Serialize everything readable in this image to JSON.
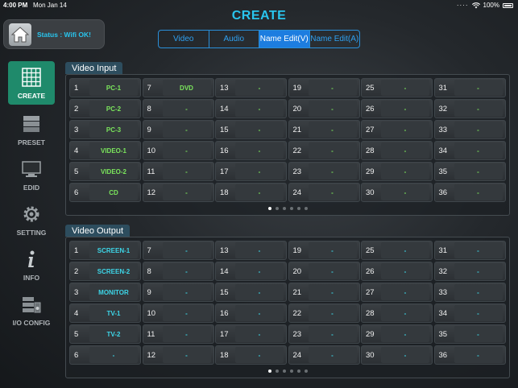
{
  "status_bar": {
    "time": "4:00 PM",
    "date": "Mon Jan 14",
    "battery": "100%"
  },
  "title": "CREATE",
  "status": {
    "text": "Status : Wifi OK!"
  },
  "tabs": [
    {
      "label": "Video",
      "active": false
    },
    {
      "label": "Audio",
      "active": false
    },
    {
      "label": "Name Edit(V)",
      "active": true
    },
    {
      "label": "Name Edit(A)",
      "active": false
    }
  ],
  "sidebar": [
    {
      "label": "CREATE",
      "icon": "grid-icon",
      "active": true
    },
    {
      "label": "PRESET",
      "icon": "preset-icon",
      "active": false
    },
    {
      "label": "EDID",
      "icon": "monitor-icon",
      "active": false
    },
    {
      "label": "SETTING",
      "icon": "gear-icon",
      "active": false
    },
    {
      "label": "INFO",
      "icon": "info-icon",
      "active": false
    },
    {
      "label": "I/O CONFIG",
      "icon": "io-config-icon",
      "active": false
    }
  ],
  "video_input": {
    "title": "Video Input",
    "page_count": 6,
    "current_page": 1,
    "cells": [
      {
        "n": "1",
        "name": "PC-1"
      },
      {
        "n": "2",
        "name": "PC-2"
      },
      {
        "n": "3",
        "name": "PC-3"
      },
      {
        "n": "4",
        "name": "VIDEO-1"
      },
      {
        "n": "5",
        "name": "VIDEO-2"
      },
      {
        "n": "6",
        "name": "CD"
      },
      {
        "n": "7",
        "name": "DVD"
      },
      {
        "n": "8",
        "name": "-"
      },
      {
        "n": "9",
        "name": "-"
      },
      {
        "n": "10",
        "name": "-"
      },
      {
        "n": "11",
        "name": "-"
      },
      {
        "n": "12",
        "name": "-"
      },
      {
        "n": "13",
        "name": "-"
      },
      {
        "n": "14",
        "name": "-"
      },
      {
        "n": "15",
        "name": "-"
      },
      {
        "n": "16",
        "name": "-"
      },
      {
        "n": "17",
        "name": "-"
      },
      {
        "n": "18",
        "name": "-"
      },
      {
        "n": "19",
        "name": "-"
      },
      {
        "n": "20",
        "name": "-"
      },
      {
        "n": "21",
        "name": "-"
      },
      {
        "n": "22",
        "name": "-"
      },
      {
        "n": "23",
        "name": "-"
      },
      {
        "n": "24",
        "name": "-"
      },
      {
        "n": "25",
        "name": "-"
      },
      {
        "n": "26",
        "name": "-"
      },
      {
        "n": "27",
        "name": "-"
      },
      {
        "n": "28",
        "name": "-"
      },
      {
        "n": "29",
        "name": "-"
      },
      {
        "n": "30",
        "name": "-"
      },
      {
        "n": "31",
        "name": "-"
      },
      {
        "n": "32",
        "name": "-"
      },
      {
        "n": "33",
        "name": "-"
      },
      {
        "n": "34",
        "name": "-"
      },
      {
        "n": "35",
        "name": "-"
      },
      {
        "n": "36",
        "name": "-"
      }
    ]
  },
  "video_output": {
    "title": "Video Output",
    "page_count": 6,
    "current_page": 1,
    "cells": [
      {
        "n": "1",
        "name": "SCREEN-1"
      },
      {
        "n": "2",
        "name": "SCREEN-2"
      },
      {
        "n": "3",
        "name": "MONITOR"
      },
      {
        "n": "4",
        "name": "TV-1"
      },
      {
        "n": "5",
        "name": "TV-2"
      },
      {
        "n": "6",
        "name": "-"
      },
      {
        "n": "7",
        "name": "-"
      },
      {
        "n": "8",
        "name": "-"
      },
      {
        "n": "9",
        "name": "-"
      },
      {
        "n": "10",
        "name": "-"
      },
      {
        "n": "11",
        "name": "-"
      },
      {
        "n": "12",
        "name": "-"
      },
      {
        "n": "13",
        "name": "-"
      },
      {
        "n": "14",
        "name": "-"
      },
      {
        "n": "15",
        "name": "-"
      },
      {
        "n": "16",
        "name": "-"
      },
      {
        "n": "17",
        "name": "-"
      },
      {
        "n": "18",
        "name": "-"
      },
      {
        "n": "19",
        "name": "-"
      },
      {
        "n": "20",
        "name": "-"
      },
      {
        "n": "21",
        "name": "-"
      },
      {
        "n": "22",
        "name": "-"
      },
      {
        "n": "23",
        "name": "-"
      },
      {
        "n": "24",
        "name": "-"
      },
      {
        "n": "25",
        "name": "-"
      },
      {
        "n": "26",
        "name": "-"
      },
      {
        "n": "27",
        "name": "-"
      },
      {
        "n": "28",
        "name": "-"
      },
      {
        "n": "29",
        "name": "-"
      },
      {
        "n": "30",
        "name": "-"
      },
      {
        "n": "31",
        "name": "-"
      },
      {
        "n": "32",
        "name": "-"
      },
      {
        "n": "33",
        "name": "-"
      },
      {
        "n": "34",
        "name": "-"
      },
      {
        "n": "35",
        "name": "-"
      },
      {
        "n": "36",
        "name": "-"
      }
    ]
  },
  "colors": {
    "accent": "#29c5ee",
    "tab_active": "#1d7de0",
    "sidebar_active": "#1f8a6b",
    "input_name": "#7be65c",
    "output_name": "#3dd6e8"
  }
}
